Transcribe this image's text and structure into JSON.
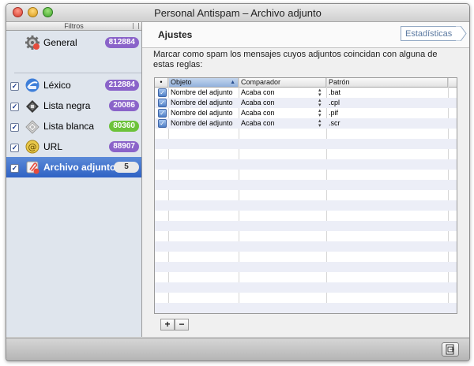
{
  "window": {
    "title": "Personal Antispam – Archivo adjunto"
  },
  "sidebar": {
    "header": "Filtros",
    "items": [
      {
        "label": "General",
        "badge": "812884",
        "badge_color": "#8a63c9",
        "checked": false,
        "selected": false,
        "icon": "gear-icon"
      },
      {
        "label": "Léxico",
        "badge": "212884",
        "badge_color": "#8a63c9",
        "checked": true,
        "selected": false,
        "icon": "lexicon-icon"
      },
      {
        "label": "Lista negra",
        "badge": "20086",
        "badge_color": "#8a63c9",
        "checked": true,
        "selected": false,
        "icon": "blacklist-icon"
      },
      {
        "label": "Lista blanca",
        "badge": "80360",
        "badge_color": "#6cc23a",
        "checked": true,
        "selected": false,
        "icon": "whitelist-icon"
      },
      {
        "label": "URL",
        "badge": "88907",
        "badge_color": "#8a63c9",
        "checked": true,
        "selected": false,
        "icon": "url-icon"
      },
      {
        "label": "Archivo adjunto",
        "badge": "5",
        "badge_color": "#e9e9e9",
        "checked": true,
        "selected": true,
        "icon": "attachment-icon"
      }
    ]
  },
  "main": {
    "title": "Ajustes",
    "stats_button": "Estadísticas",
    "description": "Marcar como spam los mensajes cuyos adjuntos coincidan con alguna de estas reglas:",
    "table": {
      "columns": [
        "•",
        "Objeto",
        "Comparador",
        "Patrón"
      ],
      "rows": [
        {
          "checked": true,
          "objeto": "Nombre del adjunto",
          "comparador": "Acaba con",
          "patron": ".bat"
        },
        {
          "checked": true,
          "objeto": "Nombre del adjunto",
          "comparador": "Acaba con",
          "patron": ".cpl"
        },
        {
          "checked": true,
          "objeto": "Nombre del adjunto",
          "comparador": "Acaba con",
          "patron": ".pif"
        },
        {
          "checked": true,
          "objeto": "Nombre del adjunto",
          "comparador": "Acaba con",
          "patron": ".scr"
        }
      ]
    },
    "add_label": "+",
    "remove_label": "−"
  }
}
